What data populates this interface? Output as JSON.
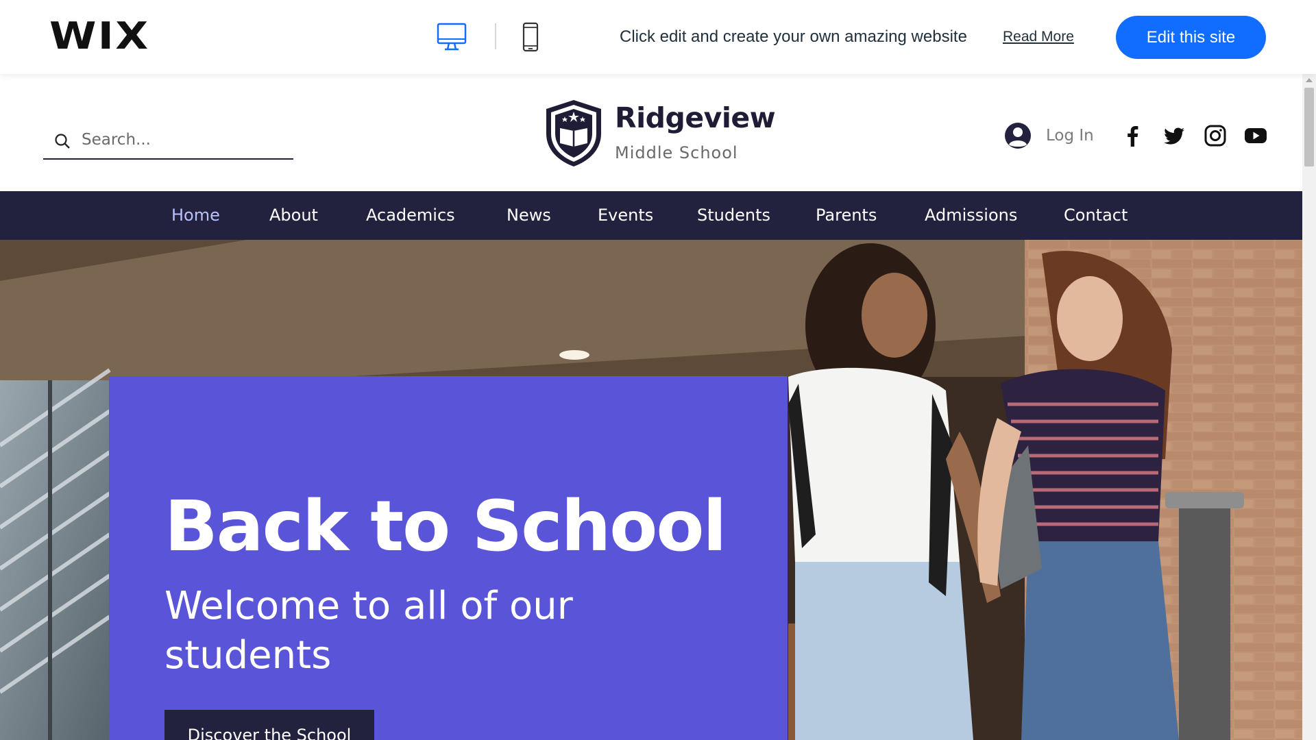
{
  "wix_bar": {
    "logo": "WIX",
    "promo_text": "Click edit and create your own amazing website",
    "read_more": "Read More",
    "edit_button": "Edit this site",
    "icons": [
      "desktop-icon",
      "mobile-icon"
    ],
    "accent_color": "#116dff"
  },
  "header": {
    "search_placeholder": "Search...",
    "school_name": "Ridgeview",
    "school_subtitle": "Middle School",
    "login_label": "Log In",
    "social_icons": [
      "facebook-icon",
      "twitter-icon",
      "instagram-icon",
      "youtube-icon"
    ]
  },
  "nav": {
    "items": [
      {
        "label": "Home",
        "active": true
      },
      {
        "label": "About"
      },
      {
        "label": "Academics"
      },
      {
        "label": "News"
      },
      {
        "label": "Events"
      },
      {
        "label": "Students"
      },
      {
        "label": "Parents"
      },
      {
        "label": "Admissions"
      },
      {
        "label": "Contact"
      }
    ],
    "background": "#23223e"
  },
  "hero": {
    "title": "Back to School",
    "subtitle": "Welcome to all of our students",
    "cta": "Discover the School",
    "panel_color": "#5a55d8"
  }
}
